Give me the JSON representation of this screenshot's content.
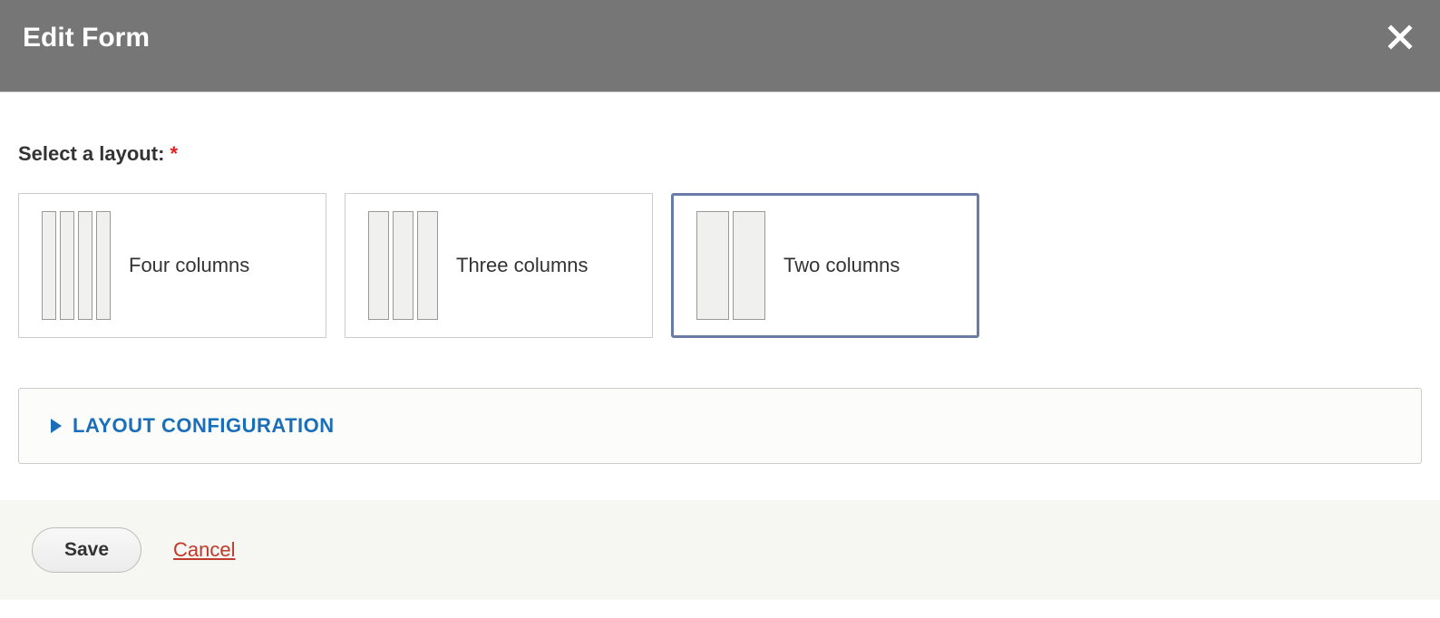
{
  "header": {
    "title": "Edit Form"
  },
  "body": {
    "select_label": "Select a layout:",
    "layouts": [
      {
        "label": "Four columns",
        "selected": false,
        "cols": 4
      },
      {
        "label": "Three columns",
        "selected": false,
        "cols": 3
      },
      {
        "label": "Two columns",
        "selected": true,
        "cols": 2
      }
    ],
    "accordion_title": "LAYOUT CONFIGURATION"
  },
  "footer": {
    "save_label": "Save",
    "cancel_label": "Cancel"
  }
}
